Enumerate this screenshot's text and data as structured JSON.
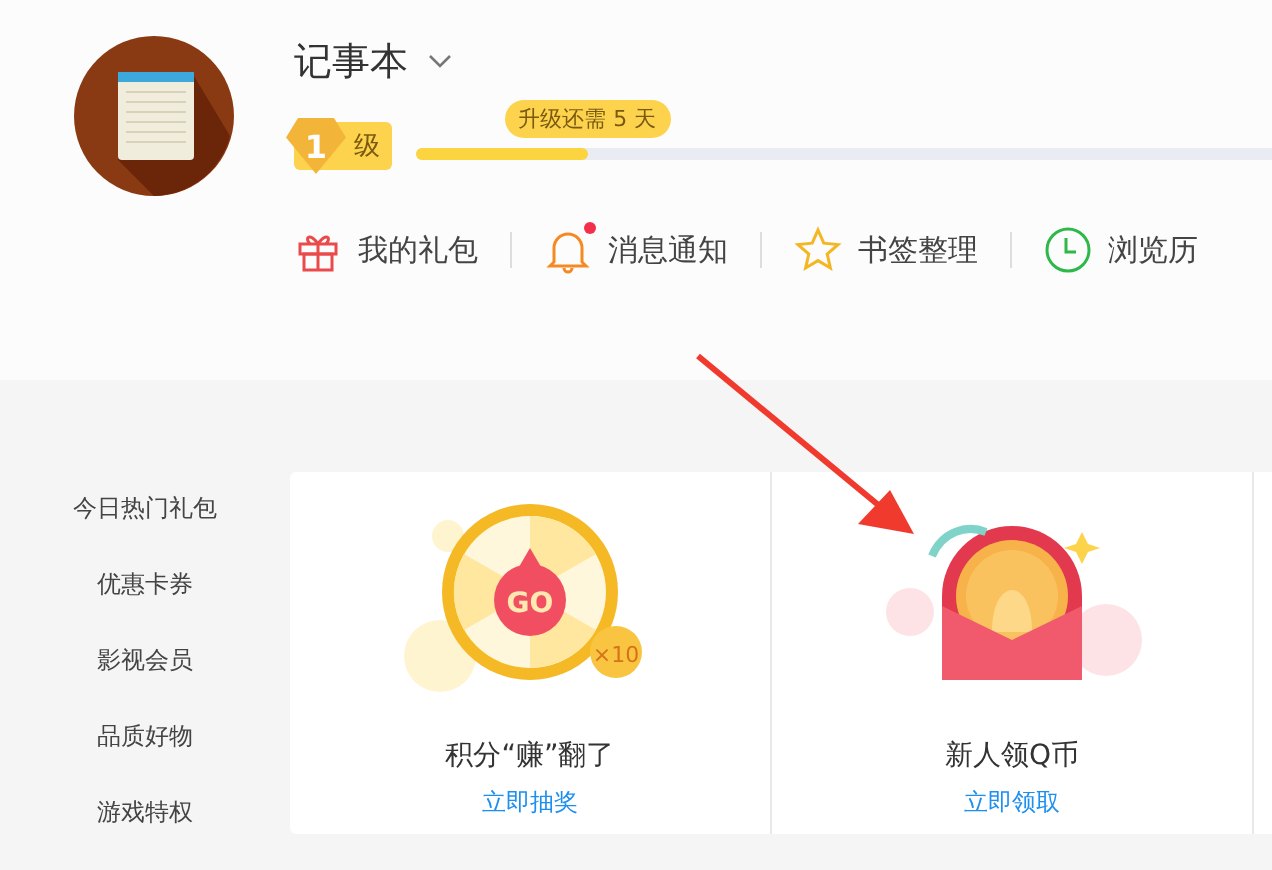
{
  "profile": {
    "name": "记事本",
    "level_number": "1",
    "level_label": "级",
    "level_tooltip": "升级还需 5 天",
    "level": 0.2
  },
  "nav": [
    {
      "label": "我的礼包",
      "kind": "gift",
      "badge": false
    },
    {
      "label": "消息通知",
      "kind": "bell",
      "badge": true
    },
    {
      "label": "书签整理",
      "kind": "star",
      "badge": false
    },
    {
      "label": "浏览历",
      "kind": "clock",
      "badge": false
    }
  ],
  "sidebar": {
    "items": [
      {
        "label": "今日热门礼包"
      },
      {
        "label": "优惠卡券"
      },
      {
        "label": "影视会员"
      },
      {
        "label": "品质好物"
      },
      {
        "label": "游戏特权"
      }
    ]
  },
  "cards": [
    {
      "kind": "wheel",
      "button_text": "GO",
      "multiplier": "×10",
      "title": "积分“赚”翻了",
      "link": "立即抽奖"
    },
    {
      "kind": "envelope",
      "title": "新人领Q币",
      "link": "立即领取"
    }
  ]
}
